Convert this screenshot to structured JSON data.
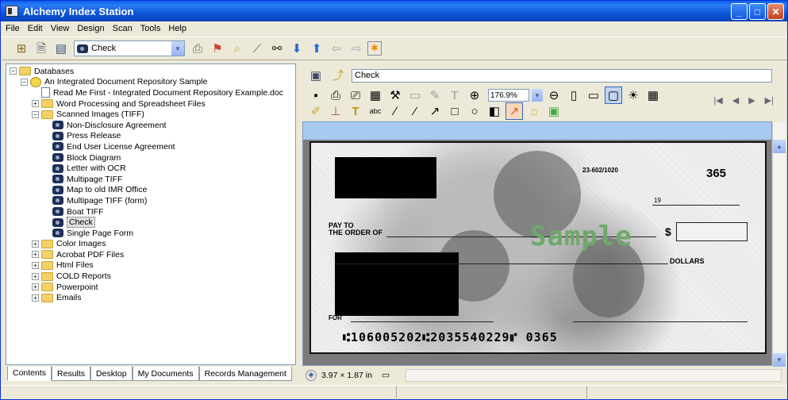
{
  "window": {
    "title": "Alchemy Index Station"
  },
  "menu": [
    "File",
    "Edit",
    "View",
    "Design",
    "Scan",
    "Tools",
    "Help"
  ],
  "toolbar": {
    "combo_value": "Check"
  },
  "tree": [
    {
      "label": "Databases",
      "level": 0,
      "type": "folder",
      "exp": "−"
    },
    {
      "label": "An Integrated Document Repository Sample",
      "level": 1,
      "type": "db",
      "exp": "−"
    },
    {
      "label": "Read Me First - Integrated Document Repository Example.doc",
      "level": 2,
      "type": "doc",
      "exp": ""
    },
    {
      "label": "Word Processing and Spreadsheet Files",
      "level": 2,
      "type": "folder",
      "exp": "+"
    },
    {
      "label": "Scanned Images (TIFF)",
      "level": 2,
      "type": "folder",
      "exp": "−"
    },
    {
      "label": "Non-Disclosure Agreement",
      "level": 3,
      "type": "cam",
      "exp": ""
    },
    {
      "label": "Press Release",
      "level": 3,
      "type": "cam",
      "exp": ""
    },
    {
      "label": "End User License Agreement",
      "level": 3,
      "type": "cam",
      "exp": ""
    },
    {
      "label": "Block Diagram",
      "level": 3,
      "type": "cam",
      "exp": ""
    },
    {
      "label": "Letter with OCR",
      "level": 3,
      "type": "cam",
      "exp": ""
    },
    {
      "label": "Multipage TIFF",
      "level": 3,
      "type": "cam",
      "exp": ""
    },
    {
      "label": "Map to old IMR Office",
      "level": 3,
      "type": "cam",
      "exp": ""
    },
    {
      "label": "Multipage TIFF (form)",
      "level": 3,
      "type": "cam",
      "exp": ""
    },
    {
      "label": "Boat TIFF",
      "level": 3,
      "type": "cam",
      "exp": ""
    },
    {
      "label": "Check",
      "level": 3,
      "type": "cam",
      "exp": "",
      "selected": true
    },
    {
      "label": "Single Page Form",
      "level": 3,
      "type": "cam",
      "exp": ""
    },
    {
      "label": "Color Images",
      "level": 2,
      "type": "folder",
      "exp": "+"
    },
    {
      "label": "Acrobat PDF Files",
      "level": 2,
      "type": "folder",
      "exp": "+"
    },
    {
      "label": "Html Files",
      "level": 2,
      "type": "folder",
      "exp": "+"
    },
    {
      "label": "COLD Reports",
      "level": 2,
      "type": "folder",
      "exp": "+"
    },
    {
      "label": "Powerpoint",
      "level": 2,
      "type": "folder",
      "exp": "+"
    },
    {
      "label": "Emails",
      "level": 2,
      "type": "folder",
      "exp": "+"
    }
  ],
  "tabs": [
    "Contents",
    "Results",
    "Desktop",
    "My Documents",
    "Records Management"
  ],
  "viewer": {
    "doc_title": "Check",
    "zoom": "176.9%",
    "dimensions": "3.97 × 1.87 in"
  },
  "check_image": {
    "routing_fraction": "23-602/1020",
    "check_number": "365",
    "pay_to_line1": "PAY TO",
    "pay_to_line2": "THE ORDER OF",
    "dollar_sign": "$",
    "dollars_label": "DOLLARS",
    "for_label": "FOR",
    "micr_line": "⑆106005202⑆2035540229⑈ 0365",
    "watermark": "Sample",
    "date_mark": "19"
  }
}
